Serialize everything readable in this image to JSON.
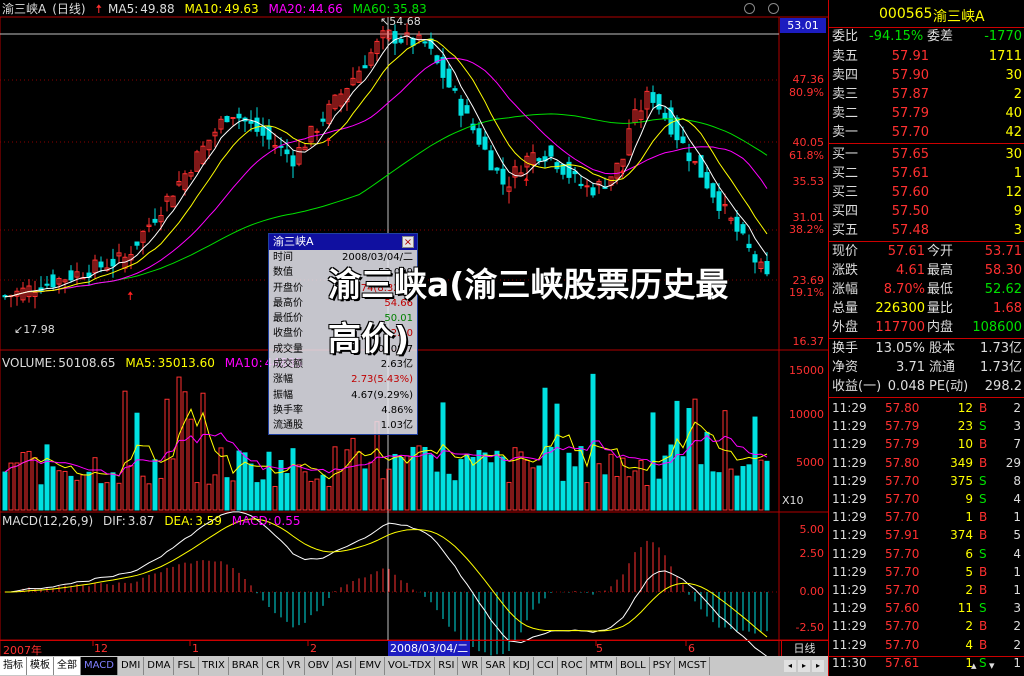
{
  "header": {
    "stock": "渝三峡A",
    "period": "日线",
    "ma5_label": "MA5:",
    "ma5": "49.88",
    "ma10_label": "MA10:",
    "ma10": "49.63",
    "ma20_label": "MA20:",
    "ma20": "44.66",
    "ma60_label": "MA60:",
    "ma60": "35.83"
  },
  "colors": {
    "up": "#ff3030",
    "down": "#00e0e0",
    "ma5": "#ffffff",
    "ma10": "#ffff00",
    "ma20": "#ff00ff",
    "ma60": "#00e000",
    "grid": "#8b0000"
  },
  "price_axis": {
    "current": "53.01",
    "labels": [
      "47.36",
      "80.9%",
      "40.05",
      "61.8%",
      "35.53",
      "31.01",
      "38.2%",
      "23.69",
      "19.1%",
      "16.37"
    ],
    "high_marker": "54.68",
    "low_marker": "17.98"
  },
  "popup": {
    "title": "渝三峡A",
    "close": "×",
    "rows": [
      {
        "label": "时间",
        "value": "2008/03/04/二"
      },
      {
        "label": "数值",
        "value": "53.009"
      },
      {
        "label": "开盘价",
        "value": "57.74(8.32%)"
      },
      {
        "label": "最高价",
        "value": "54.66"
      },
      {
        "label": "最低价",
        "value": "50.01"
      },
      {
        "label": "收盘价",
        "value": "52.00"
      },
      {
        "label": "成交量",
        "value": "50108.7"
      },
      {
        "label": "成交额",
        "value": "2.63亿"
      },
      {
        "label": "涨幅",
        "value": "2.73(5.43%)"
      },
      {
        "label": "振幅",
        "value": "4.67(9.29%)"
      },
      {
        "label": "换手率",
        "value": "4.86%"
      },
      {
        "label": "流通股",
        "value": "1.03亿"
      }
    ]
  },
  "overlay_title": "渝三峡a(渝三峡股票历史最高价)",
  "volume": {
    "label": "VOLUME:",
    "value": "50108.65",
    "ma5_label": "MA5:",
    "ma5": "35013.60",
    "ma10_label": "MA10:",
    "ma10": "44885",
    "axis": [
      "15000",
      "10000",
      "5000"
    ],
    "unit": "X10"
  },
  "macd": {
    "label": "MACD(12,26,9)",
    "dif_label": "DIF:",
    "dif": "3.87",
    "dea_label": "DEA:",
    "dea": "3.59",
    "macd_label": "MACD:",
    "macd": "0.55",
    "axis": [
      "5.00",
      "2.50",
      "0.00",
      "-2.50"
    ]
  },
  "dates": {
    "labels": [
      "2007年",
      "12",
      "1",
      "2",
      "3",
      "5",
      "6"
    ],
    "cursor": "2008/03/04/二",
    "period_btn": "日线"
  },
  "toolbar": [
    "指标",
    "模板",
    "全部",
    "MACD",
    "DMI",
    "DMA",
    "FSL",
    "TRIX",
    "BRAR",
    "CR",
    "VR",
    "OBV",
    "ASI",
    "EMV",
    "VOL-TDX",
    "RSI",
    "WR",
    "SAR",
    "KDJ",
    "CCI",
    "ROC",
    "MTM",
    "BOLL",
    "PSY",
    "MCST"
  ],
  "quote": {
    "code": "000565",
    "name": "渝三峡A",
    "weibi_label": "委比",
    "weibi": "-94.15%",
    "weicha_label": "委差",
    "weicha": "-1770",
    "sells": [
      {
        "label": "卖五",
        "price": "57.91",
        "vol": "1711"
      },
      {
        "label": "卖四",
        "price": "57.90",
        "vol": "30"
      },
      {
        "label": "卖三",
        "price": "57.87",
        "vol": "2"
      },
      {
        "label": "卖二",
        "price": "57.79",
        "vol": "40"
      },
      {
        "label": "卖一",
        "price": "57.70",
        "vol": "42"
      }
    ],
    "buys": [
      {
        "label": "买一",
        "price": "57.65",
        "vol": "30"
      },
      {
        "label": "买二",
        "price": "57.61",
        "vol": "1"
      },
      {
        "label": "买三",
        "price": "57.60",
        "vol": "12"
      },
      {
        "label": "买四",
        "price": "57.50",
        "vol": "9"
      },
      {
        "label": "买五",
        "price": "57.48",
        "vol": "3"
      }
    ],
    "stats": [
      {
        "l1": "现价",
        "v1": "57.61",
        "c1": "red",
        "l2": "今开",
        "v2": "53.71",
        "c2": "red"
      },
      {
        "l1": "涨跌",
        "v1": "4.61",
        "c1": "red",
        "l2": "最高",
        "v2": "58.30",
        "c2": "red"
      },
      {
        "l1": "涨幅",
        "v1": "8.70%",
        "c1": "red",
        "l2": "最低",
        "v2": "52.62",
        "c2": "grn"
      },
      {
        "l1": "总量",
        "v1": "226300",
        "c1": "yel",
        "l2": "量比",
        "v2": "1.68",
        "c2": "red"
      },
      {
        "l1": "外盘",
        "v1": "117700",
        "c1": "red",
        "l2": "内盘",
        "v2": "108600",
        "c2": "grn"
      }
    ],
    "stats2": [
      {
        "l1": "换手",
        "v1": "13.05%",
        "l2": "股本",
        "v2": "1.73亿"
      },
      {
        "l1": "净资",
        "v1": "3.71",
        "l2": "流通",
        "v2": "1.73亿"
      },
      {
        "l1": "收益(一)",
        "v1": "0.048",
        "l2": "PE(动)",
        "v2": "298.2"
      }
    ]
  },
  "ticks": [
    {
      "t": "11:29",
      "p": "57.80",
      "v": "12",
      "s": "B",
      "n": "2"
    },
    {
      "t": "11:29",
      "p": "57.79",
      "v": "23",
      "s": "S",
      "n": "3"
    },
    {
      "t": "11:29",
      "p": "57.79",
      "v": "10",
      "s": "B",
      "n": "7"
    },
    {
      "t": "11:29",
      "p": "57.80",
      "v": "349",
      "s": "B",
      "n": "29"
    },
    {
      "t": "11:29",
      "p": "57.70",
      "v": "375",
      "s": "S",
      "n": "8"
    },
    {
      "t": "11:29",
      "p": "57.70",
      "v": "9",
      "s": "S",
      "n": "4"
    },
    {
      "t": "11:29",
      "p": "57.70",
      "v": "1",
      "s": "B",
      "n": "1"
    },
    {
      "t": "11:29",
      "p": "57.91",
      "v": "374",
      "s": "B",
      "n": "5"
    },
    {
      "t": "11:29",
      "p": "57.70",
      "v": "6",
      "s": "S",
      "n": "4"
    },
    {
      "t": "11:29",
      "p": "57.70",
      "v": "5",
      "s": "B",
      "n": "1"
    },
    {
      "t": "11:29",
      "p": "57.70",
      "v": "2",
      "s": "B",
      "n": "1"
    },
    {
      "t": "11:29",
      "p": "57.60",
      "v": "11",
      "s": "S",
      "n": "3"
    },
    {
      "t": "11:29",
      "p": "57.70",
      "v": "2",
      "s": "B",
      "n": "2"
    },
    {
      "t": "11:29",
      "p": "57.70",
      "v": "4",
      "s": "B",
      "n": "2"
    },
    {
      "t": "11:30",
      "p": "57.61",
      "v": "1",
      "s": "S",
      "n": "1"
    }
  ]
}
